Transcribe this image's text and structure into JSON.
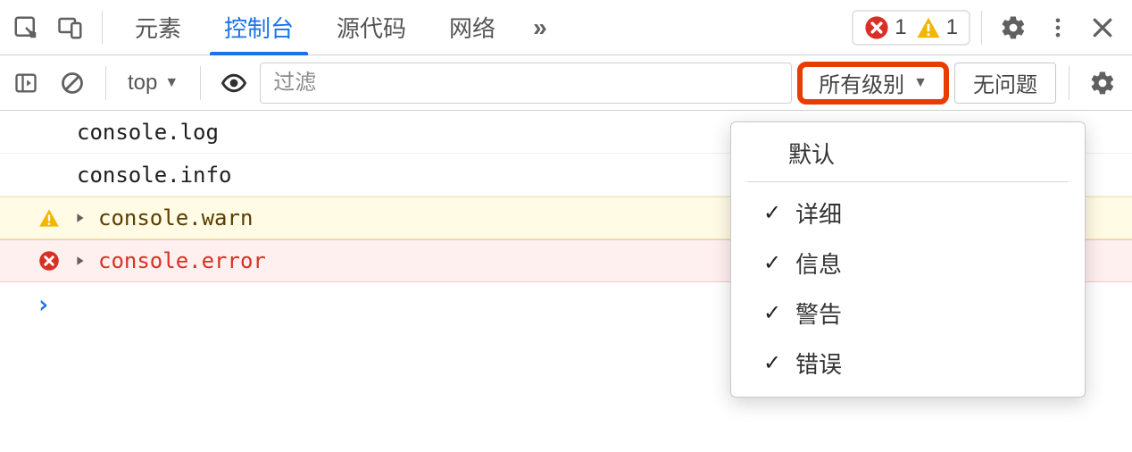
{
  "tabs": {
    "items": [
      {
        "label": "元素",
        "active": false
      },
      {
        "label": "控制台",
        "active": true
      },
      {
        "label": "源代码",
        "active": false
      },
      {
        "label": "网络",
        "active": false
      }
    ],
    "overflow_glyph": "»"
  },
  "status": {
    "error_count": "1",
    "warning_count": "1"
  },
  "toolbar": {
    "context_label": "top",
    "filter_placeholder": "过滤",
    "level_button_label": "所有级别",
    "issues_button_label": "无问题"
  },
  "console_rows": [
    {
      "kind": "plain",
      "text": "console.log"
    },
    {
      "kind": "plain",
      "text": "console.info"
    },
    {
      "kind": "warn",
      "text": "console.warn"
    },
    {
      "kind": "error",
      "text": "console.error"
    }
  ],
  "prompt_glyph": "›",
  "level_menu": {
    "header": "默认",
    "items": [
      {
        "label": "详细",
        "checked": true
      },
      {
        "label": "信息",
        "checked": true
      },
      {
        "label": "警告",
        "checked": true
      },
      {
        "label": "错误",
        "checked": true
      }
    ]
  }
}
